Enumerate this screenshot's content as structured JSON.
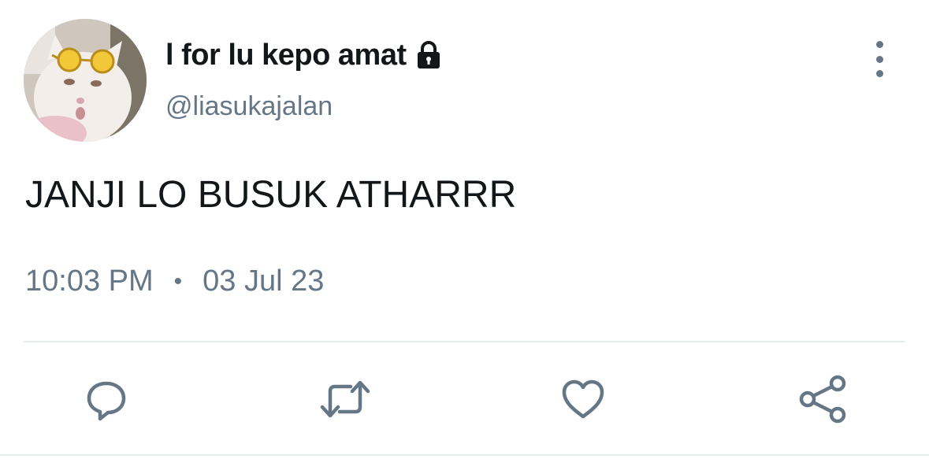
{
  "tweet": {
    "display_name": "l for lu kepo amat",
    "username": "@liasukajalan",
    "protected_icon": "lock-icon",
    "text": "JANJI LO BUSUK ATHARRR",
    "time": "10:03 PM",
    "separator": "•",
    "date": "03 Jul 23"
  },
  "actions": {
    "reply_icon": "reply-icon",
    "retweet_icon": "retweet-icon",
    "like_icon": "heart-icon",
    "share_icon": "share-icon",
    "more_icon": "more-vertical-icon"
  },
  "colors": {
    "text_primary": "#14171a",
    "text_secondary": "#657786",
    "divider": "#e6ecf0",
    "background": "#ffffff"
  }
}
